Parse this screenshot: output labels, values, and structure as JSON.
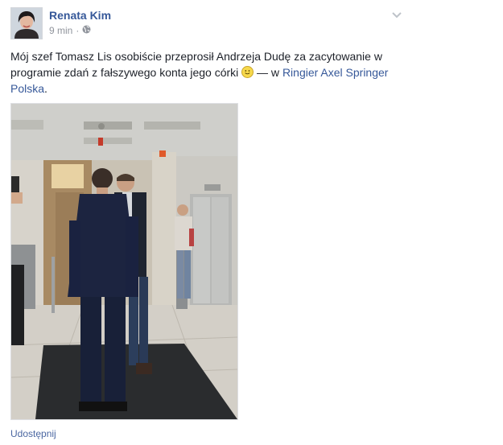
{
  "post": {
    "author": "Renata Kim",
    "time": "9 min",
    "separator": "·",
    "audience_icon": "globe-icon",
    "options_icon": "chevron-down-icon",
    "text_before": "Mój szef Tomasz Lis osobiście przeprosił Andrzeja Dudę za zacytowanie w programie zdań z fałszywego konta jego córki ",
    "emoji": "smiley-icon",
    "text_mid": " — w ",
    "place": "Ringier Axel Springer Polska",
    "text_after": "."
  },
  "actions": {
    "share": "Udostępnij"
  },
  "colors": {
    "link": "#365899",
    "meta": "#90949c",
    "text": "#1d2129"
  }
}
